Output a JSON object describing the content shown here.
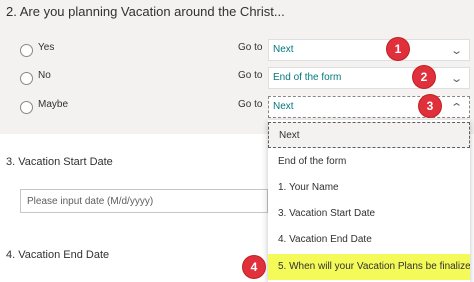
{
  "question2": {
    "title": "2. Are you planning Vacation around the Christ...",
    "options": [
      {
        "label": "Yes",
        "goto_label": "Go to",
        "selected_value": "Next"
      },
      {
        "label": "No",
        "goto_label": "Go to",
        "selected_value": "End of the form"
      },
      {
        "label": "Maybe",
        "goto_label": "Go to",
        "selected_value": "Next"
      }
    ]
  },
  "question3": {
    "title": "3. Vacation Start Date",
    "input_placeholder": "Please input date (M/d/yyyy)"
  },
  "question4": {
    "title": "4. Vacation End Date"
  },
  "dropdown": {
    "items": [
      "Next",
      "End of the form",
      "1. Your Name",
      "3. Vacation Start Date",
      "4. Vacation End Date",
      "5. When will your Vacation Plans be finalize..."
    ],
    "highlighted_index": 5
  },
  "badges": [
    "1",
    "2",
    "3",
    "4"
  ],
  "colors": {
    "badge": "#e0303b",
    "highlight": "#f4fa58",
    "select_text": "#03787c"
  }
}
